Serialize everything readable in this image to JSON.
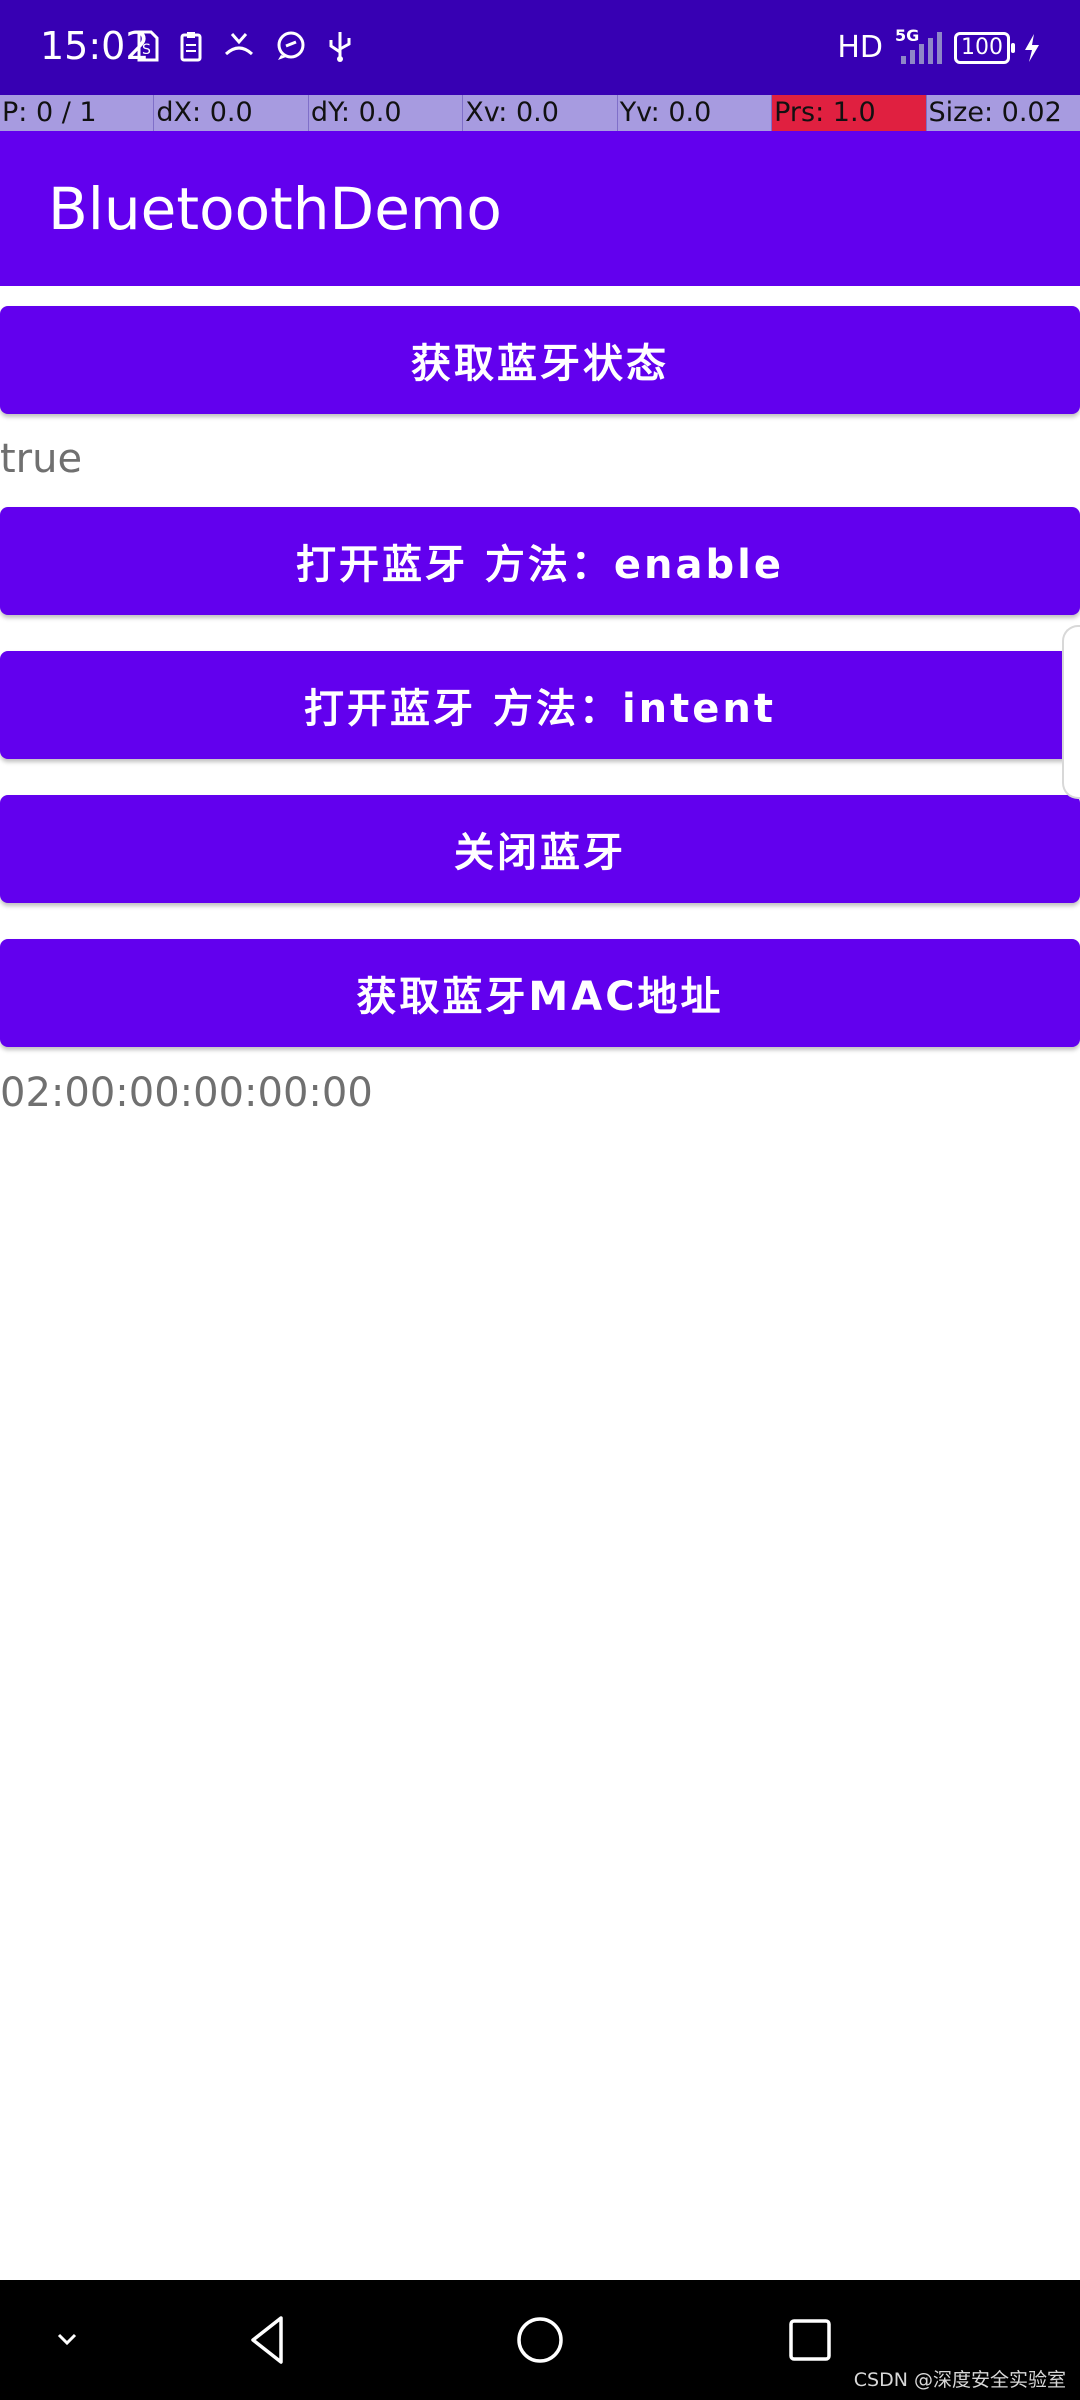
{
  "status_bar": {
    "time": "15:02",
    "network_label": "HD",
    "network_type": "5G",
    "battery_level": "100",
    "left_icons": [
      "sim-card-icon",
      "clipboard-icon",
      "missed-call-icon",
      "chat-bubble-icon",
      "usb-icon"
    ],
    "right_icons": [
      "signal-icon",
      "battery-icon",
      "charging-icon"
    ]
  },
  "pointer_overlay": {
    "p": "P: 0 / 1",
    "dx": "dX: 0.0",
    "dy": "dY: 0.0",
    "xv": "Xv: 0.0",
    "yv": "Yv: 0.0",
    "prs": "Prs: 1.0",
    "size": "Size: 0.02"
  },
  "app_bar": {
    "title": "BluetoothDemo"
  },
  "buttons": {
    "get_state": "获取蓝牙状态",
    "open_enable": "打开蓝牙 方法：enable",
    "open_intent": "打开蓝牙 方法：intent",
    "close": "关闭蓝牙",
    "get_mac": "获取蓝牙MAC地址"
  },
  "results": {
    "state": "true",
    "mac": "02:00:00:00:00:00"
  },
  "nav_bar": {
    "icons": [
      "hide-nav-icon",
      "back-icon",
      "home-icon",
      "recent-apps-icon"
    ]
  },
  "watermark": "CSDN @深度安全实验室",
  "colors": {
    "status_bar": "#3700b3",
    "primary": "#6200ee",
    "overlay": "#a79be0",
    "pressure_highlight": "#e02040"
  }
}
